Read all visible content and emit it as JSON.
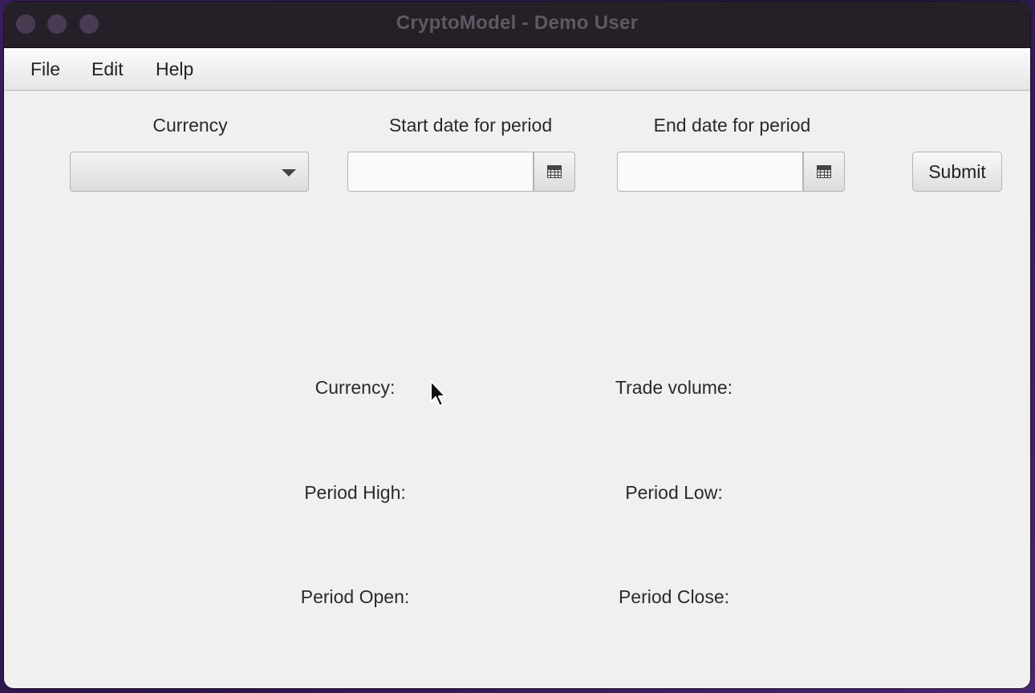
{
  "window": {
    "title": "CryptoModel - Demo User"
  },
  "menu": {
    "file": "File",
    "edit": "Edit",
    "help": "Help"
  },
  "form": {
    "currency_header": "Currency",
    "start_header": "Start date for period",
    "end_header": "End date for period",
    "currency_value": "",
    "start_value": "",
    "end_value": "",
    "submit_label": "Submit"
  },
  "results": {
    "currency_label": "Currency:",
    "trade_volume_label": "Trade volume:",
    "period_high_label": "Period High:",
    "period_low_label": "Period Low:",
    "period_open_label": "Period Open:",
    "period_close_label": "Period Close:"
  },
  "icons": {
    "combo_arrow": "chevron-down-icon",
    "date_picker": "calendar-icon",
    "cursor": "mouse-pointer-icon"
  }
}
